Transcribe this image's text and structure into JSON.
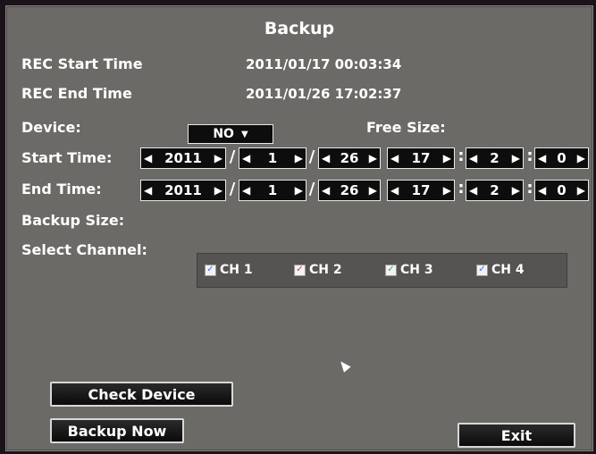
{
  "title": "Backup",
  "rec_start": {
    "label": "REC Start Time",
    "value": "2011/01/17 00:03:34"
  },
  "rec_end": {
    "label": "REC End Time",
    "value": "2011/01/26 17:02:37"
  },
  "device": {
    "label": "Device:",
    "value": "NO",
    "free_size_label": "Free Size:"
  },
  "start_time": {
    "label": "Start Time:",
    "year": "2011",
    "month": "1",
    "day": "26",
    "hour": "17",
    "minute": "2",
    "second": "0"
  },
  "end_time": {
    "label": "End Time:",
    "year": "2011",
    "month": "1",
    "day": "26",
    "hour": "17",
    "minute": "2",
    "second": "0"
  },
  "date_sep": "/",
  "time_sep": ":",
  "backup_size_label": "Backup Size:",
  "select_channel_label": "Select Channel:",
  "channels": [
    {
      "label": "CH 1",
      "checked": true,
      "color": "#3b6fd6"
    },
    {
      "label": "CH 2",
      "checked": true,
      "color": "#d23a3a"
    },
    {
      "label": "CH 3",
      "checked": true,
      "color": "#3aa84a"
    },
    {
      "label": "CH 4",
      "checked": true,
      "color": "#3b6fd6"
    }
  ],
  "buttons": {
    "check_device": "Check Device",
    "backup_now": "Backup Now",
    "exit": "Exit"
  }
}
